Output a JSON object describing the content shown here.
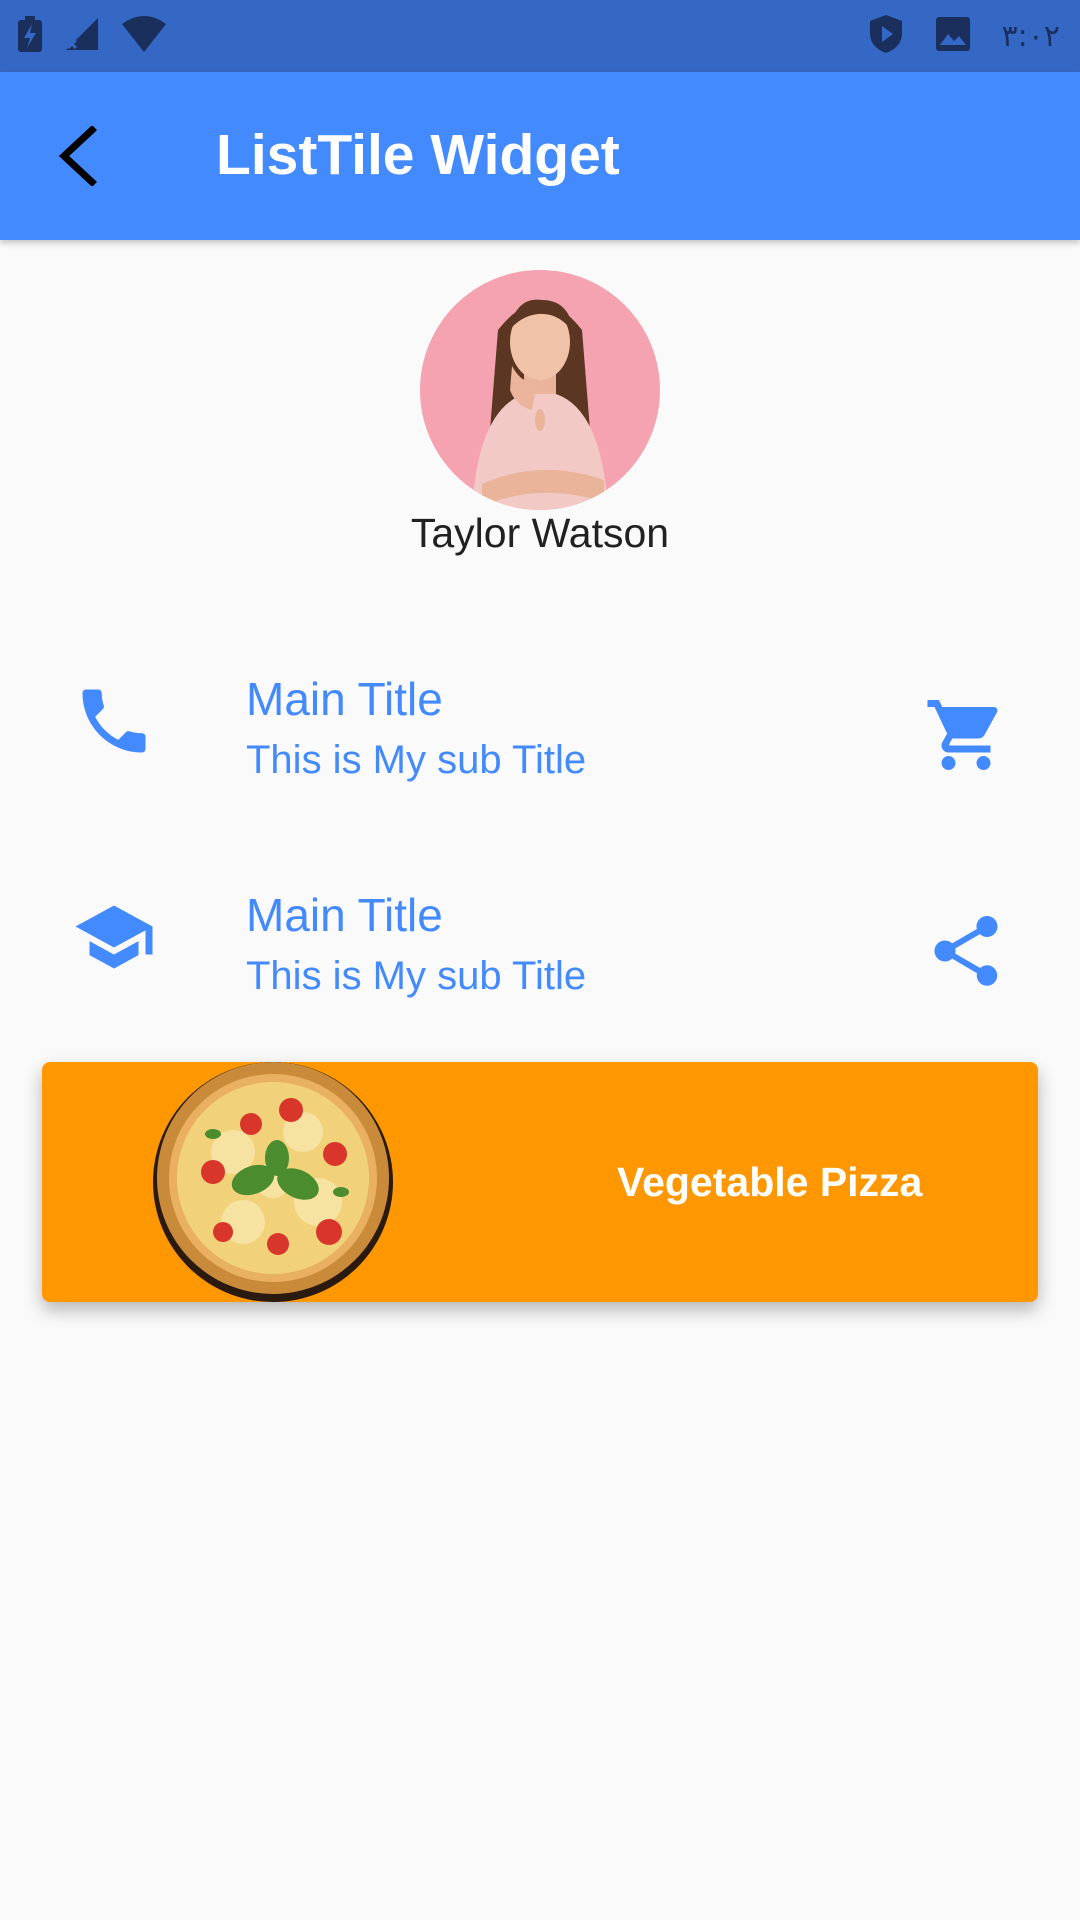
{
  "status_bar": {
    "time": "۳:۰۲",
    "icons": [
      "battery-charging-icon",
      "signal-off-icon",
      "wifi-icon",
      "shield-play-icon",
      "image-icon"
    ]
  },
  "app_bar": {
    "title": "ListTile Widget",
    "back_icon": "arrow-back-icon",
    "color": "#448aff"
  },
  "profile": {
    "name": "Taylor Watson",
    "avatar_background": "#f5a3b0"
  },
  "list_tiles": [
    {
      "title": "Main Title",
      "subtitle": "This is My sub Title",
      "leading_icon": "phone-icon",
      "trailing_icon": "shopping-cart-icon"
    },
    {
      "title": "Main Title",
      "subtitle": "This is My sub Title",
      "leading_icon": "graduation-cap-icon",
      "trailing_icon": "share-icon"
    }
  ],
  "card": {
    "label": "Vegetable Pizza",
    "color": "#ff9800"
  },
  "colors": {
    "accent": "#448aff",
    "status_bar": "#3567c4",
    "background": "#fafafa"
  }
}
